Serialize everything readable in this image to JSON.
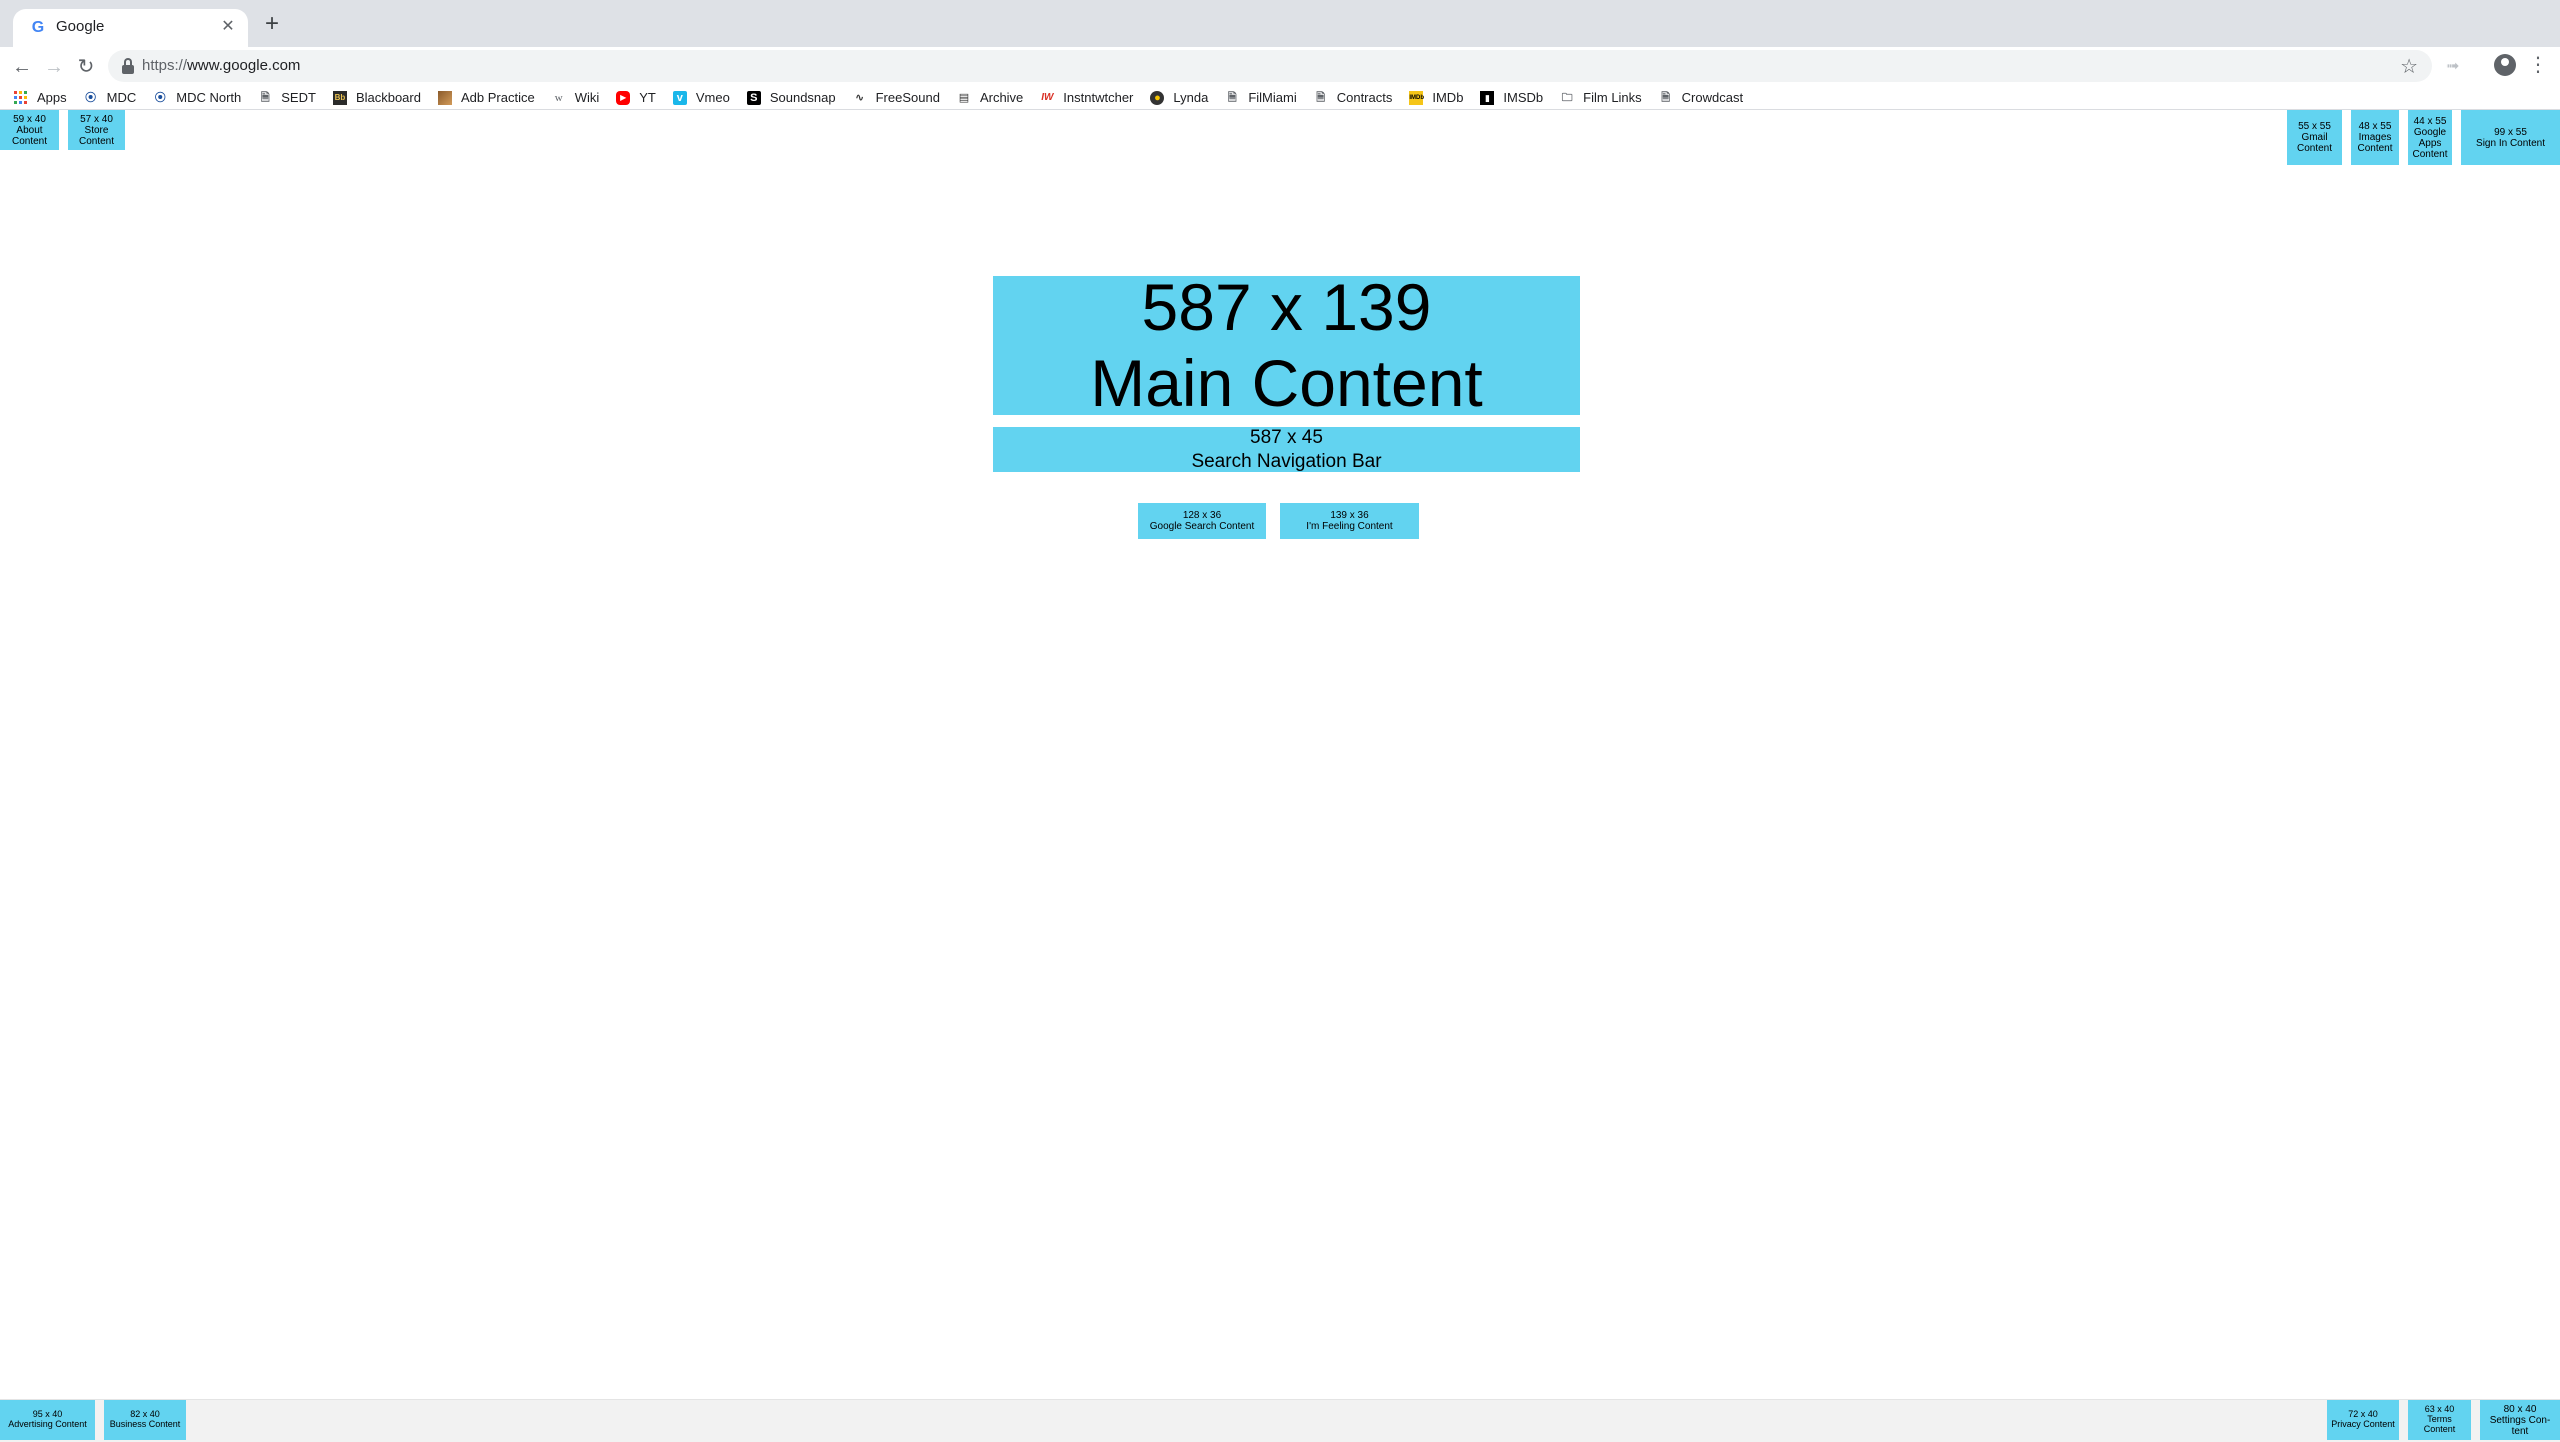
{
  "browser": {
    "tab": {
      "title": "Google",
      "favicon": "G",
      "close": "✕"
    },
    "new_tab": "+",
    "url_scheme": "https://",
    "url_host": "www.google.com",
    "bookmarks": [
      {
        "label": "Apps",
        "icon": "apps-grid-icon"
      },
      {
        "label": "MDC",
        "icon": "mdc-icon"
      },
      {
        "label": "MDC North",
        "icon": "mdc-icon"
      },
      {
        "label": "SEDT",
        "icon": "page-icon"
      },
      {
        "label": "Blackboard",
        "icon": "blackboard-icon"
      },
      {
        "label": "Adb Practice",
        "icon": "adb-icon"
      },
      {
        "label": "Wiki",
        "icon": "wiki-icon"
      },
      {
        "label": "YT",
        "icon": "youtube-icon"
      },
      {
        "label": "Vmeo",
        "icon": "vimeo-icon"
      },
      {
        "label": "Soundsnap",
        "icon": "soundsnap-icon"
      },
      {
        "label": "FreeSound",
        "icon": "waveform-icon"
      },
      {
        "label": "Archive",
        "icon": "archive-icon"
      },
      {
        "label": "Instntwtcher",
        "icon": "iw-icon"
      },
      {
        "label": "Lynda",
        "icon": "lynda-icon"
      },
      {
        "label": "FilMiami",
        "icon": "page-icon"
      },
      {
        "label": "Contracts",
        "icon": "page-icon"
      },
      {
        "label": "IMDb",
        "icon": "imdb-icon"
      },
      {
        "label": "IMSDb",
        "icon": "clapper-icon"
      },
      {
        "label": "Film Links",
        "icon": "folder-icon"
      },
      {
        "label": "Crowdcast",
        "icon": "page-icon"
      }
    ]
  },
  "wireframe": {
    "box_color": "#62d3f0",
    "main": {
      "dims": "587 x 139",
      "label": "Main Content"
    },
    "search_bar": {
      "dims": "587 x 45",
      "label": "Search Navigation Bar"
    },
    "google_search": {
      "dims": "128 x 36",
      "label": "Google Search Content"
    },
    "feeling_lucky": {
      "dims": "139 x 36",
      "label": "I'm Feeling Content"
    },
    "about": {
      "dims": "59 x 40",
      "label1": "About",
      "label2": "Content"
    },
    "store": {
      "dims": "57 x 40",
      "label1": "Store",
      "label2": "Content"
    },
    "gmail": {
      "dims": "55 x 55",
      "label1": "Gmail",
      "label2": "Content"
    },
    "images": {
      "dims": "48 x 55",
      "label1": "Images",
      "label2": "Content"
    },
    "google_apps": {
      "dims": "44 x 55",
      "label1": "Google",
      "label2": "Apps",
      "label3": "Content"
    },
    "sign_in": {
      "dims": "99 x 55",
      "label": "Sign In Content"
    },
    "advertising": {
      "dims": "95 x 40",
      "label": "Advertising Content"
    },
    "business": {
      "dims": "82 x 40",
      "label": "Business Content"
    },
    "privacy": {
      "dims": "72 x 40",
      "label": "Privacy Content"
    },
    "terms": {
      "dims": "63 x 40",
      "label1": "Terms",
      "label2": "Content"
    },
    "settings": {
      "dims": "80 x 40",
      "label1": "Settings Con-",
      "label2": "tent"
    }
  }
}
